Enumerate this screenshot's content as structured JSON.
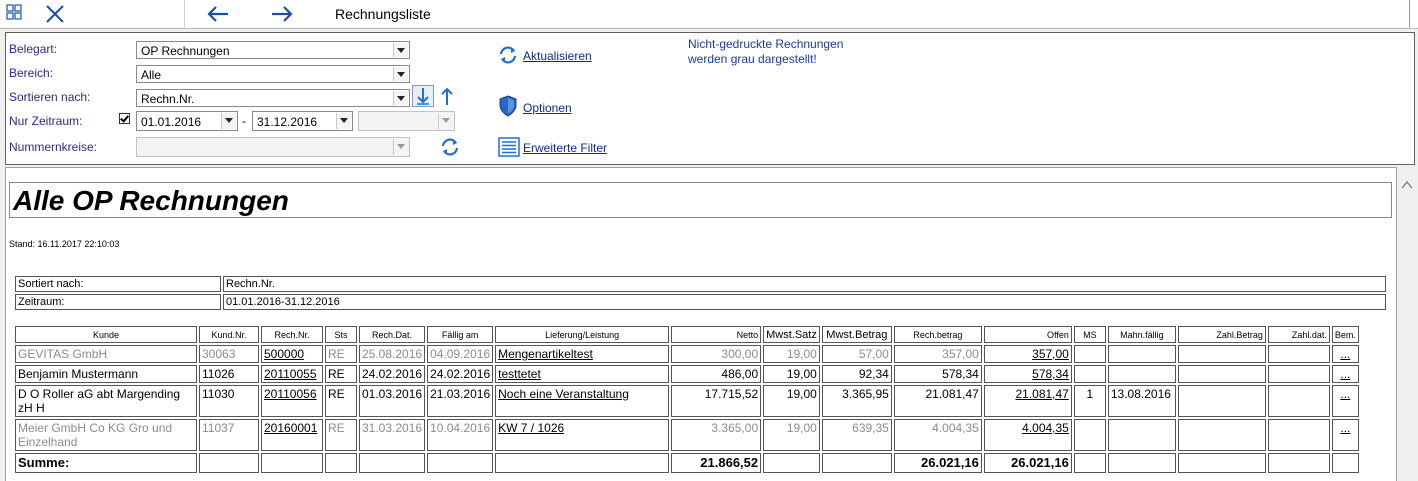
{
  "toolbar": {
    "title": "Rechnungsliste",
    "icons": [
      "grid-view-icon",
      "close-icon",
      "back-arrow-icon",
      "forward-arrow-icon"
    ]
  },
  "filter": {
    "belegart_label": "Belegart:",
    "belegart_value": "OP Rechnungen",
    "bereich_label": "Bereich:",
    "bereich_value": "Alle",
    "sortieren_label": "Sortieren nach:",
    "sortieren_value": "Rechn.Nr.",
    "zeitraum_label": "Nur Zeitraum:",
    "zeitraum_checked": true,
    "zeitraum_from": "01.01.2016",
    "zeitraum_sep": "-",
    "zeitraum_to": "31.12.2016",
    "zeitraum_preset": "",
    "nummernkreise_label": "Nummernkreise:",
    "nummernkreise_value": "",
    "aktualisieren": "Aktualisieren",
    "optionen": "Optionen",
    "erweiterte_filter": "Erweiterte Filter",
    "note_line1": "Nicht-gedruckte Rechnungen",
    "note_line2": "werden grau dargestellt!",
    "accent_color": "#1e6fd6"
  },
  "report": {
    "title": "Alle OP Rechnungen",
    "stand": "Stand: 16.11.2017 22:10:03",
    "sortiert_label": "Sortiert nach:",
    "sortiert_value": "Rechn.Nr.",
    "zeitraum_label": "Zeitraum:",
    "zeitraum_value": "01.01.2016-31.12.2016",
    "columns": [
      "Kunde",
      "Kund.Nr.",
      "Rech.Nr.",
      "Sts",
      "Rech.Dat.",
      "Fällig am",
      "Lieferung/Leistung",
      "Netto",
      "Mwst.Satz",
      "Mwst.Betrag",
      "Rech.betrag",
      "Offen",
      "MS",
      "Mahn.fällig",
      "Zahl.Betrag",
      "Zahl.dat.",
      "Bem."
    ],
    "rows": [
      {
        "grey": true,
        "kunde": "GEVITAS GmbH",
        "kundnr": "30063",
        "rechnr": "500000",
        "sts": "RE",
        "rechdat": "25.08.2016",
        "faellig": "04.09.2016",
        "leistung": "Mengenartikeltest",
        "netto": "300,00",
        "mwst_satz": "19,00",
        "mwst_betrag": "57,00",
        "rechbetrag": "357,00",
        "offen": "357,00",
        "ms": "",
        "mahn": "",
        "zahlbetrag": "",
        "zahldat": "",
        "bem": "..."
      },
      {
        "grey": false,
        "kunde": "Benjamin Mustermann",
        "kundnr": "11026",
        "rechnr": "20110055",
        "sts": "RE",
        "rechdat": "24.02.2016",
        "faellig": "24.02.2016",
        "leistung": "testtetet",
        "netto": "486,00",
        "mwst_satz": "19,00",
        "mwst_betrag": "92,34",
        "rechbetrag": "578,34",
        "offen": "578,34",
        "ms": "",
        "mahn": "",
        "zahlbetrag": "",
        "zahldat": "",
        "bem": "..."
      },
      {
        "grey": false,
        "kunde": "D O Roller aG abt Margending zH H",
        "kundnr": "11030",
        "rechnr": "20110056",
        "sts": "RE",
        "rechdat": "01.03.2016",
        "faellig": "21.03.2016",
        "leistung": "Noch eine Veranstaltung",
        "netto": "17.715,52",
        "mwst_satz": "19,00",
        "mwst_betrag": "3.365,95",
        "rechbetrag": "21.081,47",
        "offen": "21.081,47",
        "ms": "1",
        "mahn": "13.08.2016",
        "zahlbetrag": "",
        "zahldat": "",
        "bem": "..."
      },
      {
        "grey": true,
        "kunde": "Meier GmbH Co KG Gro und Einzelhand",
        "kundnr": "11037",
        "rechnr": "20160001",
        "sts": "RE",
        "rechdat": "31.03.2016",
        "faellig": "10.04.2016",
        "leistung": "KW 7 / 1026",
        "netto": "3.365,00",
        "mwst_satz": "19,00",
        "mwst_betrag": "639,35",
        "rechbetrag": "4.004,35",
        "offen": "4.004,35",
        "ms": "",
        "mahn": "",
        "zahlbetrag": "",
        "zahldat": "",
        "bem": "..."
      }
    ],
    "summe_label": "Summe:",
    "summe_netto": "21.866,52",
    "summe_rechbetrag": "26.021,16",
    "summe_offen": "26.021,16"
  }
}
